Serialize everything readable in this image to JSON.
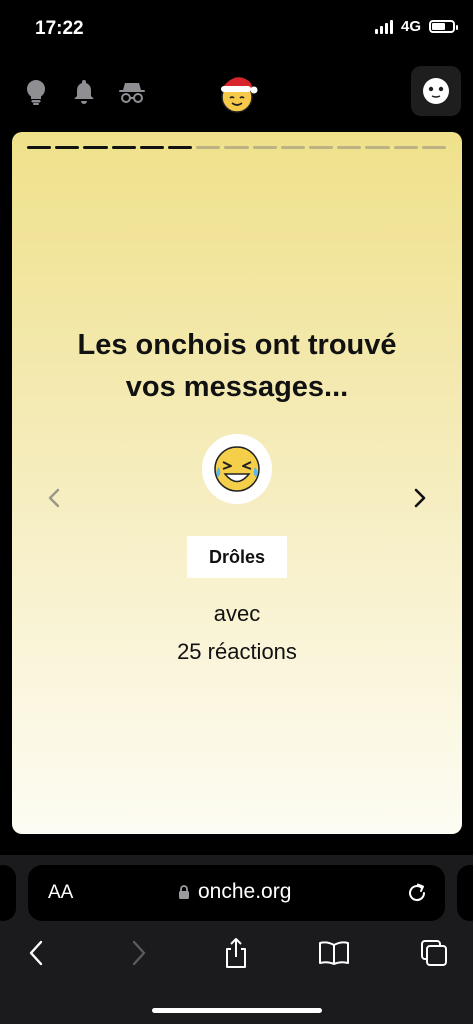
{
  "status_bar": {
    "time": "17:22",
    "network": "4G"
  },
  "story": {
    "progress": {
      "total": 15,
      "completed": 6
    },
    "title_line1": "Les onchois ont trouvé",
    "title_line2": "vos messages...",
    "category": "Drôles",
    "avec": "avec",
    "reactions": "25 réactions",
    "card_colors": {
      "top": "#efe18a",
      "bottom": "#fdfcf3"
    }
  },
  "browser": {
    "aa_label": "AA",
    "url": "onche.org"
  },
  "icons": [
    "lightbulb-icon",
    "bell-icon",
    "incognito-icon",
    "santa-smiley-logo",
    "avatar-icon",
    "crying-laughing-emoji",
    "chevron-left-icon",
    "chevron-right-icon",
    "lock-icon",
    "reload-icon",
    "back-icon",
    "forward-icon",
    "share-icon",
    "bookmarks-icon",
    "tabs-icon"
  ]
}
